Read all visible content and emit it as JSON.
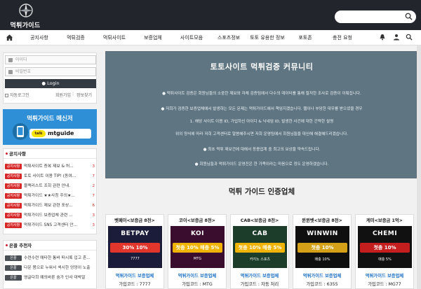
{
  "brand": {
    "logo_text": "먹튀가이드"
  },
  "nav": {
    "items": [
      "공지사항",
      "먹튀검증",
      "먹튀사이트",
      "보증업체",
      "사이트모음",
      "스포츠정보",
      "토토 유용한 정보",
      "포토존",
      "충전 요청"
    ]
  },
  "login": {
    "id_placeholder": "아이디",
    "pw_placeholder": "비밀번호",
    "button": "Login",
    "auto_login": "자동로그인",
    "signup": "회원가입",
    "find": "정보찾기"
  },
  "banner": {
    "title": "먹튀가이드 메신저",
    "kakao": "talk",
    "kakao_id": "mtguide"
  },
  "notice": {
    "title": "공지사항",
    "rows": [
      {
        "tag": "공지사항",
        "text": "먹튀사이트 증복 제보 & 허...",
        "count": "3"
      },
      {
        "tag": "공지사항",
        "text": "토토 사이트 이용 TIP! (동여...",
        "count": "7"
      },
      {
        "tag": "공지사항",
        "text": "블랙리스트 조회 관련 안내.",
        "count": "2"
      },
      {
        "tag": "공지사항",
        "text": "먹튀가이드 ★★사칭 주의★...",
        "count": "7"
      },
      {
        "tag": "공지사항",
        "text": "먹튀가이드 제보 관련 포상...",
        "count": "6"
      },
      {
        "tag": "공지사항",
        "text": "먹튀가이드 보증업체 관련 ...",
        "count": "3"
      },
      {
        "tag": "공지사항",
        "text": "먹튀가이드 SNS 고객센터 안...",
        "count": "3"
      }
    ]
  },
  "recommend": {
    "title": "은꼴 추천자",
    "rows": [
      {
        "tag": "은꼴",
        "text": "수련수련 애타한 통바 떠시록 입고 흔..."
      },
      {
        "tag": "은꼴",
        "text": "다운 몸으로 누워서 섹시한 엉덩이 노출"
      },
      {
        "tag": "은꼴",
        "text": "영글다희 예의바른 숨가 인사 대박얼"
      }
    ]
  },
  "hero": {
    "title": "토토사이트 먹튀검증 커뮤니티",
    "lines": [
      "● 먹튀사이트 검증은 회원님들의 소중한 제보와 자체 검증팀에서 다수의 데이터를 통해 철저한 조사로 검증이 이뤄집니다.",
      "● 저희가 검증한 보증업체에서 발생하는 모든 문제는 먹튀가이드에서 책임지겠습니다. 웹이나 부당한 대우를 받으셨을 경우",
      "1. 해당 사이트 이용 ID, 가입하신 아이디 & 닉네임 ID, 발생한 사건에 대한 간략한 설명",
      "위의 양식에 따라 저희 고객센터로 말씀해주시면 저희 운영팀에서 회원님들을 대신해 해결해드리겠습니다.",
      "● 최초 먹튀 제보건에 대해서 동종업계 중 최고의 보상을 약속드립니다.",
      "● 회원님들과 먹튀가이드 운영진은 한 가족이라는 마음으로 정도 운영하겠습니다."
    ]
  },
  "section": {
    "title": "먹튀 가이드 인증업체"
  },
  "cards": [
    {
      "name": "벳페이<보증금 8천>",
      "brand": "BETPAY",
      "bonus": "30% 10%",
      "sub": "7777",
      "verify": "먹튀가이드 보증업체",
      "code": "가입코드 : 7777",
      "bg": "#1b1b3a",
      "accent": "#e0362b"
    },
    {
      "name": "코이<보증금 8천>",
      "brand": "KOI",
      "bonus": "첫충 10% 매충 5%",
      "sub": "MTG",
      "verify": "먹튀가이드 보증업체",
      "code": "가입코드 : MTG",
      "bg": "#3a0d2e",
      "accent": "#f0b400"
    },
    {
      "name": "CAB<보증금 8천>",
      "brand": "CAB",
      "bonus": "첫충 10% 매충 5%",
      "sub": "카지노 스포츠",
      "verify": "먹튀가이드 보증업체",
      "code": "가입코드 : 자동 처리",
      "bg": "#1c3d2a",
      "accent": "#f0b400"
    },
    {
      "name": "윈윈벳<보증금 8천>",
      "brand": "WINWIN",
      "bonus": "첫충 10%",
      "sub": "매충 10%",
      "verify": "먹튀가이드 보증업체",
      "code": "가입코드 : 6355",
      "bg": "#0f0f0f",
      "accent": "#d4a017"
    },
    {
      "name": "케미<보증금 1억>",
      "brand": "CHEMI",
      "bonus": "첫충 10%",
      "sub": "매충 5%",
      "verify": "먹튀가이드 보증업체",
      "code": "가입코드 : MG77",
      "bg": "#111111",
      "accent": "#c41e1e"
    }
  ]
}
